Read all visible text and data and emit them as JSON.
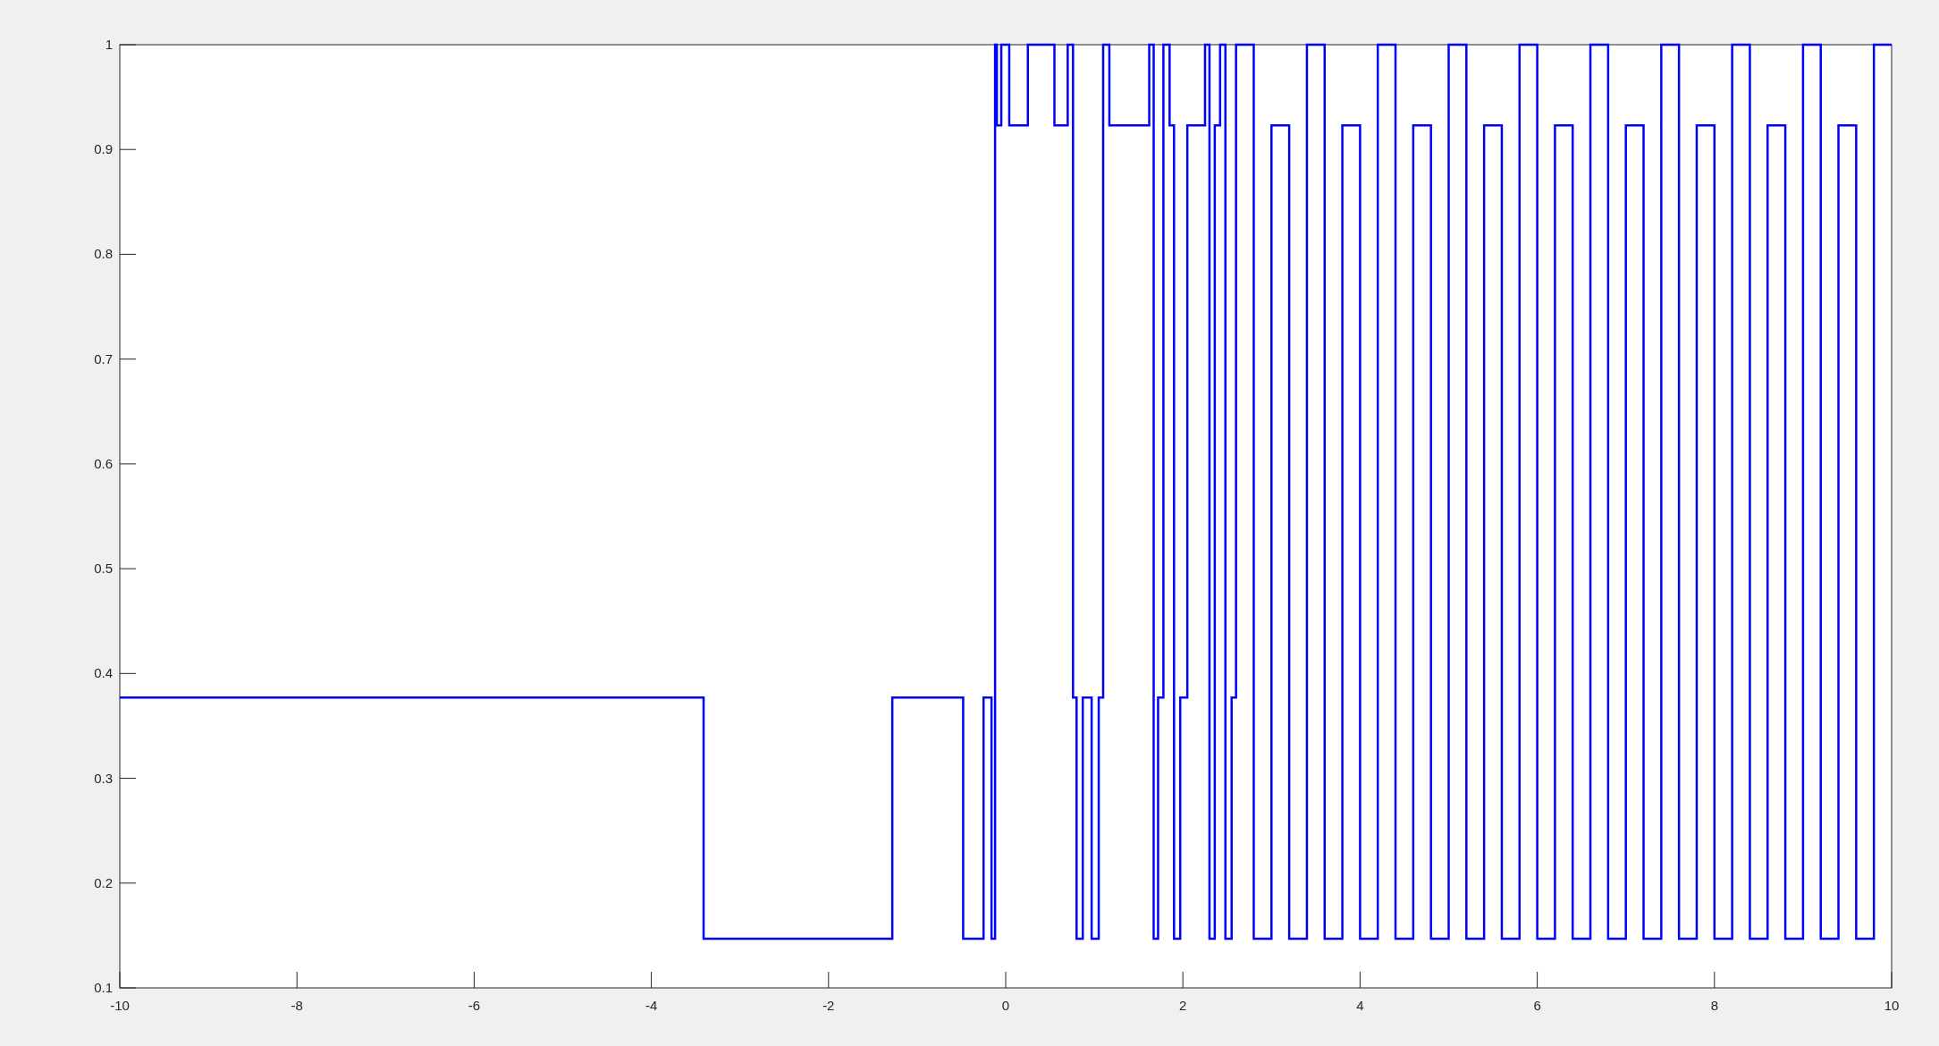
{
  "figure": {
    "chart_data": {
      "type": "line",
      "xlim": [
        -10,
        10
      ],
      "ylim": [
        0.1,
        1
      ],
      "xticks": [
        -10,
        -8,
        -6,
        -4,
        -2,
        0,
        2,
        4,
        6,
        8,
        10
      ],
      "yticks": [
        0.1,
        0.2,
        0.3,
        0.4,
        0.5,
        0.6,
        0.7,
        0.8,
        0.9,
        1
      ],
      "x": [
        -10,
        -3.41,
        -3.41,
        -1.28,
        -1.28,
        -0.48,
        -0.48,
        -0.25,
        -0.25,
        -0.16,
        -0.16,
        -0.12,
        -0.12,
        -0.1,
        -0.1,
        -0.05,
        -0.05,
        0.04,
        0.04,
        0.25,
        0.25,
        0.55,
        0.55,
        0.7,
        0.7,
        0.76,
        0.76,
        0.8,
        0.8,
        0.87,
        0.87,
        0.97,
        0.97,
        1.05,
        1.05,
        1.1,
        1.1,
        1.17,
        1.17,
        1.62,
        1.62,
        1.67,
        1.67,
        1.72,
        1.72,
        1.78,
        1.78,
        1.85,
        1.85,
        1.9,
        1.9,
        1.97,
        1.97,
        2.05,
        2.05,
        2.25,
        2.25,
        2.3,
        2.3,
        2.36,
        2.36,
        2.42,
        2.42,
        2.48,
        2.48,
        2.55,
        2.55,
        2.6,
        2.6,
        2.8,
        2.8,
        3,
        3,
        3.2,
        3.2,
        3.4,
        3.4,
        3.6,
        3.6,
        3.8,
        3.8,
        4,
        4,
        4.2,
        4.2,
        4.4,
        4.4,
        4.6,
        4.6,
        4.8,
        4.8,
        5,
        5,
        5.2,
        5.2,
        5.4,
        5.4,
        5.6,
        5.6,
        5.8,
        5.8,
        6,
        6,
        6.2,
        6.2,
        6.4,
        6.4,
        6.6,
        6.6,
        6.8,
        6.8,
        7,
        7,
        7.2,
        7.2,
        7.4,
        7.4,
        7.6,
        7.6,
        7.8,
        7.8,
        8,
        8,
        8.2,
        8.2,
        8.4,
        8.4,
        8.6,
        8.6,
        8.8,
        8.8,
        9,
        9,
        9.2,
        9.2,
        9.4,
        9.4,
        9.6,
        9.6,
        9.8,
        9.8,
        10
      ],
      "series": [
        {
          "color": "#0000ff",
          "values": [
            0.377,
            0.377,
            0.147,
            0.147,
            0.377,
            0.377,
            0.147,
            0.147,
            0.377,
            0.377,
            0.147,
            0.147,
            1,
            1,
            0.923,
            0.923,
            1,
            1,
            0.923,
            0.923,
            1,
            1,
            0.923,
            0.923,
            1,
            1,
            0.377,
            0.377,
            0.147,
            0.147,
            0.377,
            0.377,
            0.147,
            0.147,
            0.377,
            0.377,
            1,
            1,
            0.923,
            0.923,
            1,
            1,
            0.147,
            0.147,
            0.377,
            0.377,
            1,
            1,
            0.923,
            0.923,
            0.147,
            0.147,
            0.377,
            0.377,
            0.923,
            0.923,
            1,
            1,
            0.147,
            0.147,
            0.923,
            0.923,
            1,
            1,
            0.147,
            0.147,
            0.377,
            0.377,
            1,
            1,
            0.147,
            0.147,
            0.923,
            0.923,
            0.147,
            0.147,
            1,
            1,
            0.147,
            0.147,
            0.923,
            0.923,
            0.147,
            0.147,
            1,
            1,
            0.147,
            0.147,
            0.923,
            0.923,
            0.147,
            0.147,
            1,
            1,
            0.147,
            0.147,
            0.923,
            0.923,
            0.147,
            0.147,
            1,
            1,
            0.147,
            0.147,
            0.923,
            0.923,
            0.147,
            0.147,
            1,
            1,
            0.147,
            0.147,
            0.923,
            0.923,
            0.147,
            0.147,
            1,
            1,
            0.147,
            0.147,
            0.923,
            0.923,
            0.147,
            0.147,
            1,
            1,
            0.147,
            0.147,
            0.923,
            0.923,
            0.147,
            0.147,
            1,
            1,
            0.147,
            0.147,
            0.923,
            0.923,
            0.147,
            0.147,
            1,
            1
          ]
        }
      ]
    }
  }
}
